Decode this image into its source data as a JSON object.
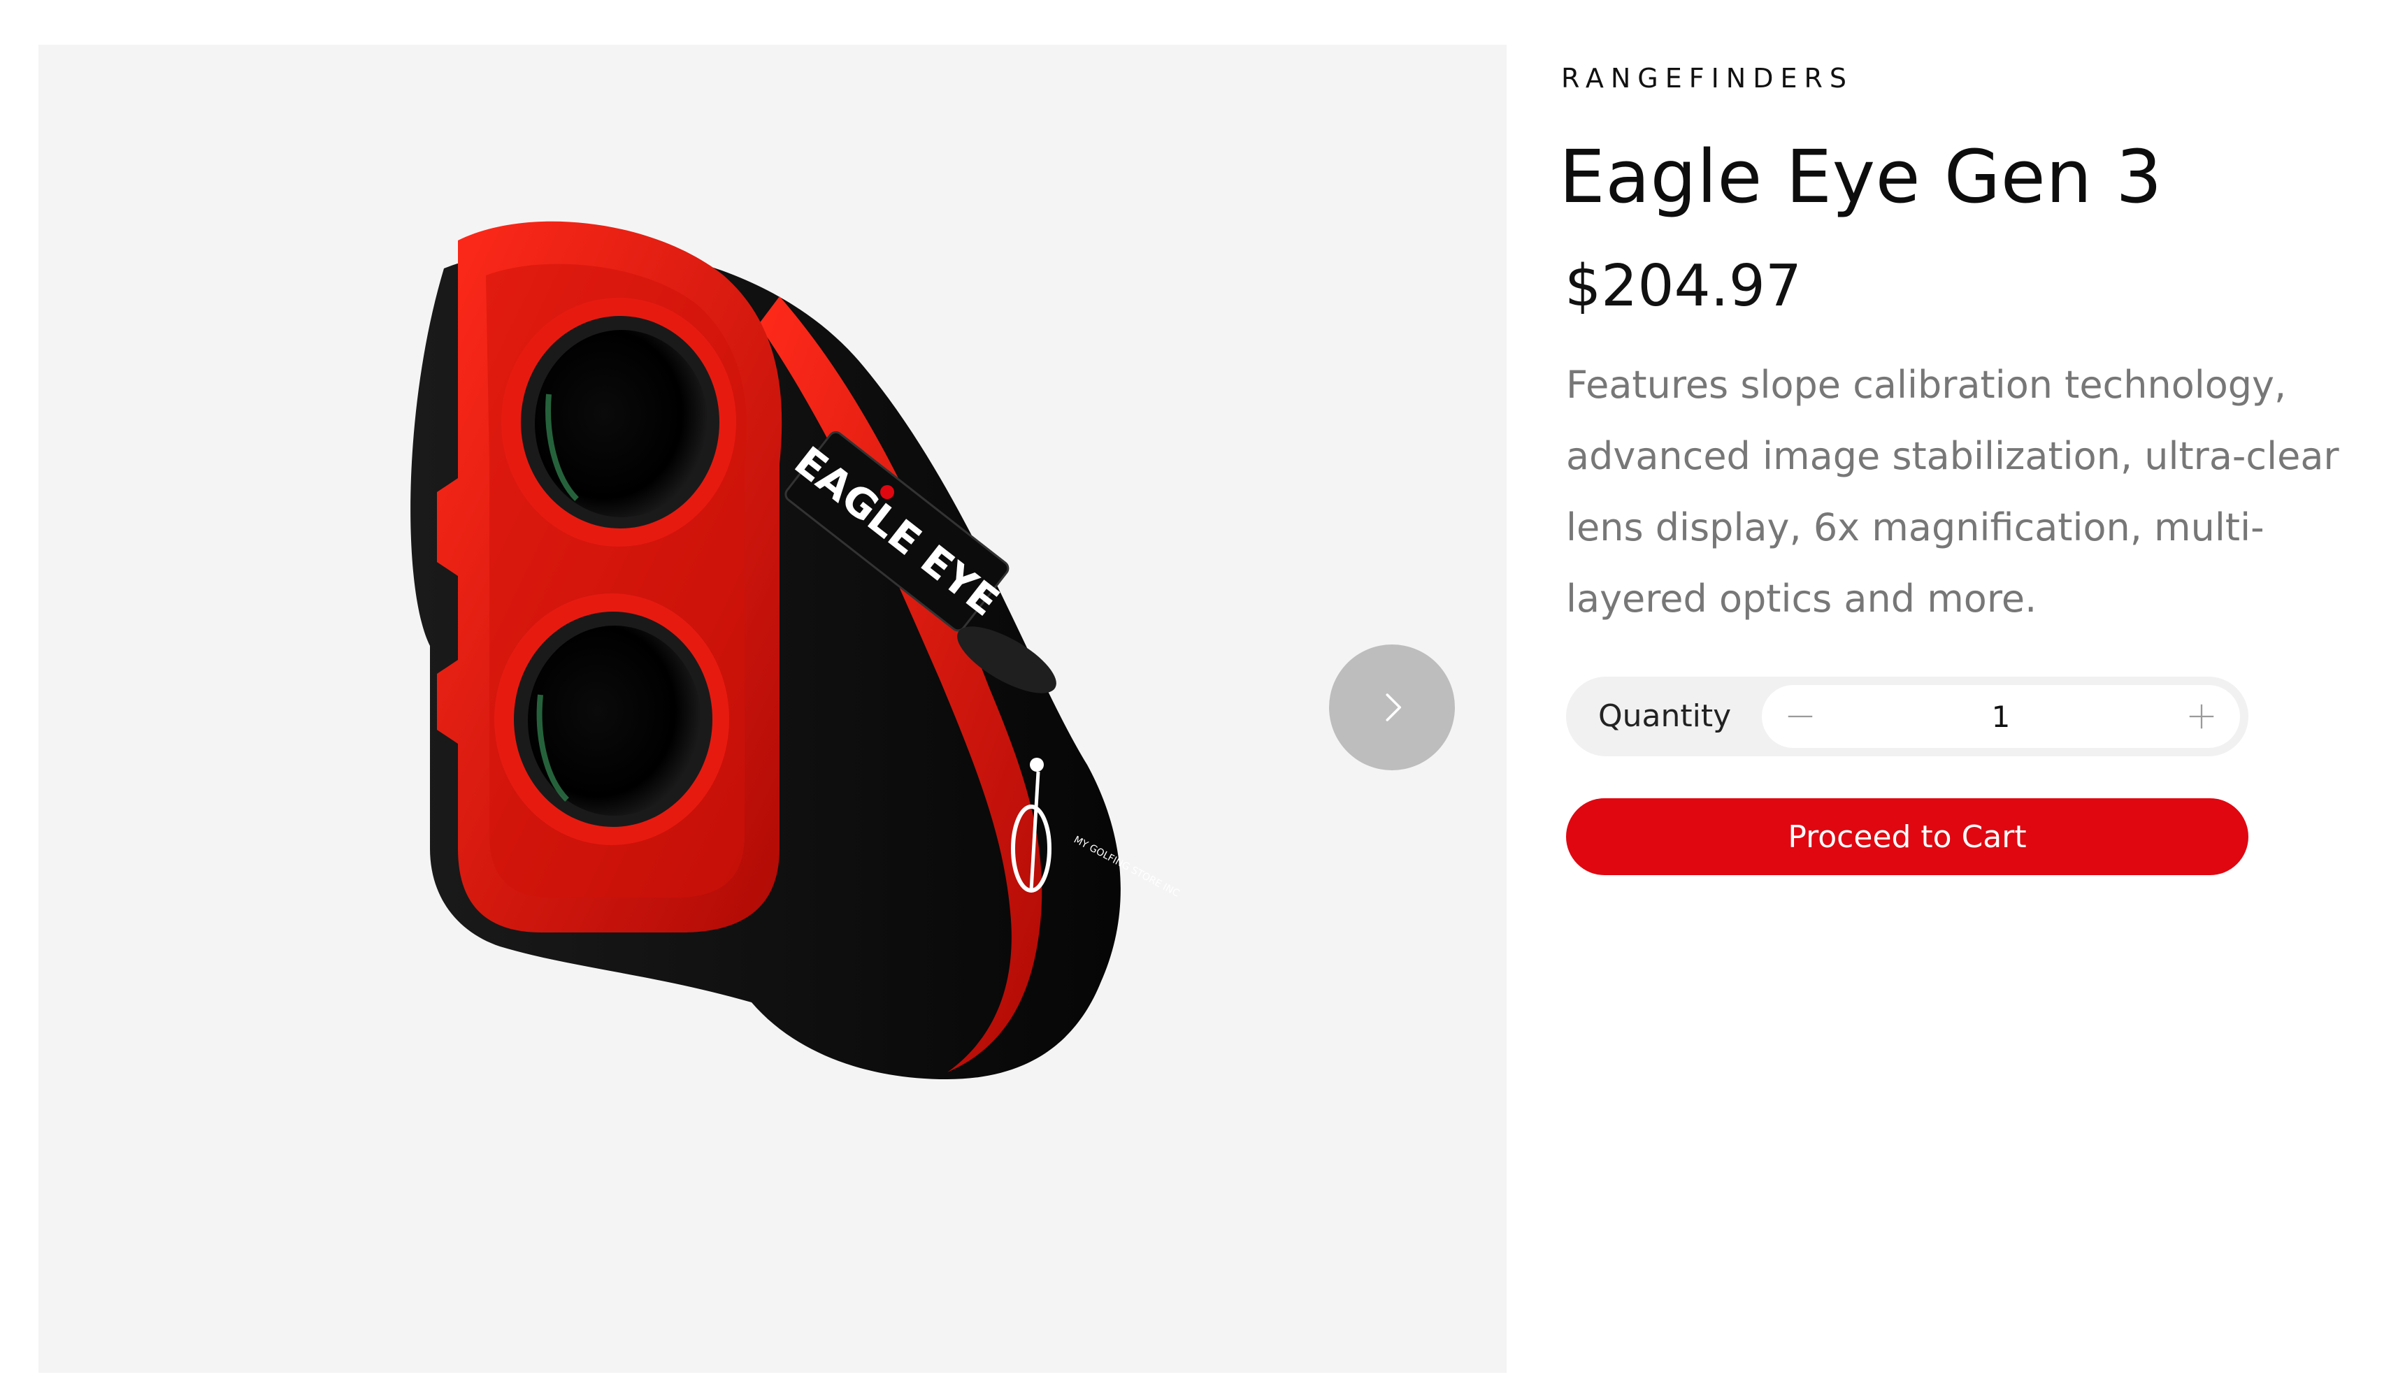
{
  "product": {
    "category": "RANGEFINDERS",
    "title": "Eagle Eye Gen 3",
    "price": "$204.97",
    "description": "Features slope calibration technology, advanced image stabilization, ultra-clear lens display, 6x magnification, multi-layered optics and more.",
    "image_brand_text": "EAGLE EYE",
    "image_logo_text": "MY GOLFING STORE INC"
  },
  "quantity": {
    "label": "Quantity",
    "value": "1"
  },
  "actions": {
    "cart_label": "Proceed to Cart"
  },
  "icons": {
    "next": "chevron-right-icon",
    "minus": "minus-icon",
    "plus": "plus-icon"
  },
  "colors": {
    "accent": "#e00711",
    "gallery_bg": "#f4f4f4",
    "text_muted": "#777777",
    "product_red": "#d8140e",
    "product_black": "#111111"
  }
}
